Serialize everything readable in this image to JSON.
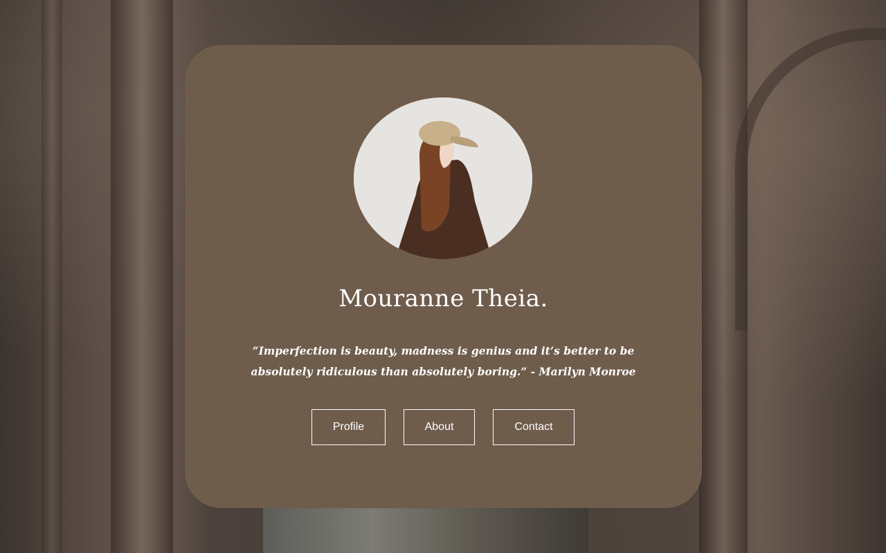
{
  "profile": {
    "name": "Mouranne Theia.",
    "quote": "“Imperfection is beauty, madness is genius and it’s better to be absolutely ridiculous than absolutely boring.” - Marilyn Monroe",
    "avatar": {
      "icon": "profile-photo"
    }
  },
  "nav": {
    "profile_label": "Profile",
    "about_label": "About",
    "contact_label": "Contact"
  },
  "colors": {
    "card": "#6f5c4b",
    "text": "#ffffff",
    "button_border": "#ffffff"
  }
}
